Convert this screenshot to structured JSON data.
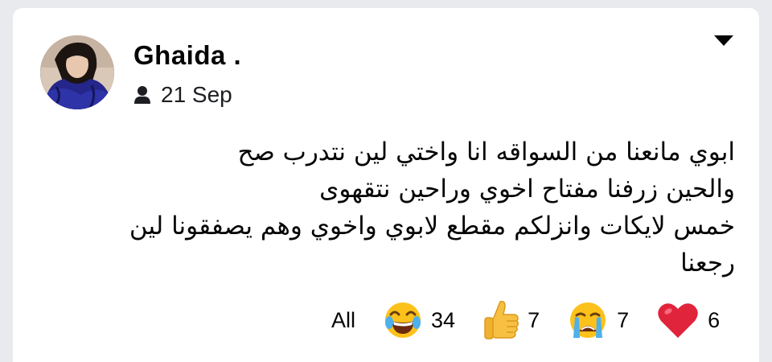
{
  "post": {
    "author": "Ghaida .",
    "audience_icon": "person-icon",
    "date": "21 Sep",
    "lines": [
      "ابوي مانعنا من السواقه انا واختي لين نتدرب صح",
      "والحين زرفنا مفتاح اخوي وراحين نتقهوى",
      "خمس لايكات وانزلكم مقطع لابوي واخوي وهم يصفقونا لين",
      "رجعنا"
    ]
  },
  "reactions": {
    "all_label": "All",
    "items": [
      {
        "icon": "laughing-emoji-icon",
        "count": "34"
      },
      {
        "icon": "thumbs-up-icon",
        "count": "7"
      },
      {
        "icon": "crying-emoji-icon",
        "count": "7"
      },
      {
        "icon": "heart-icon",
        "count": "6"
      }
    ]
  },
  "colors": {
    "background": "#e9eaed",
    "card": "#ffffff",
    "text": "#050505",
    "heart": "#e0243c",
    "emoji_yellow": "#fcc21b"
  }
}
